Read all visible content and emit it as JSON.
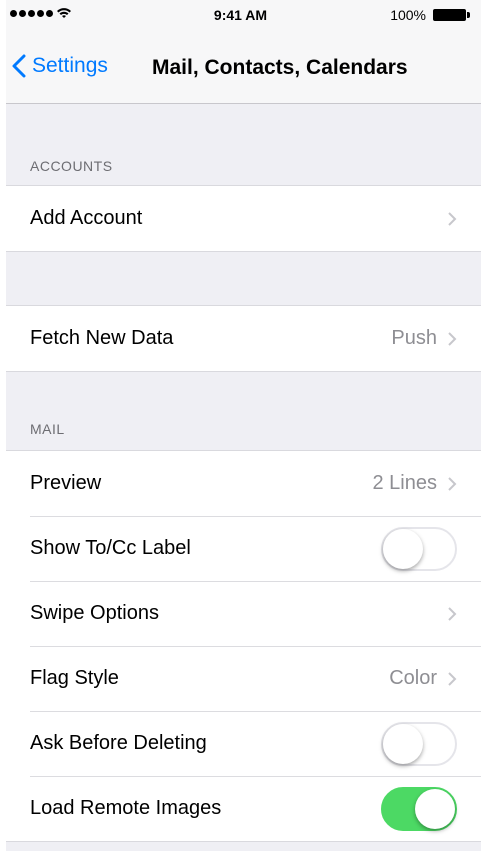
{
  "status_bar": {
    "time": "9:41 AM",
    "battery": "100%"
  },
  "nav": {
    "back_label": "Settings",
    "title": "Mail, Contacts, Calendars"
  },
  "accounts": {
    "header": "ACCOUNTS",
    "add_account": "Add Account"
  },
  "fetch": {
    "label": "Fetch New Data",
    "value": "Push"
  },
  "mail": {
    "header": "MAIL",
    "rows": [
      {
        "label": "Preview",
        "value": "2 Lines",
        "type": "disclosure"
      },
      {
        "label": "Show To/Cc Label",
        "type": "toggle",
        "on": false
      },
      {
        "label": "Swipe Options",
        "type": "disclosure"
      },
      {
        "label": "Flag Style",
        "value": "Color",
        "type": "disclosure"
      },
      {
        "label": "Ask Before Deleting",
        "type": "toggle",
        "on": false
      },
      {
        "label": "Load Remote Images",
        "type": "toggle",
        "on": true
      }
    ]
  },
  "colors": {
    "accent": "#007aff",
    "toggle_on": "#4cd964",
    "group_bg": "#efeff4"
  }
}
